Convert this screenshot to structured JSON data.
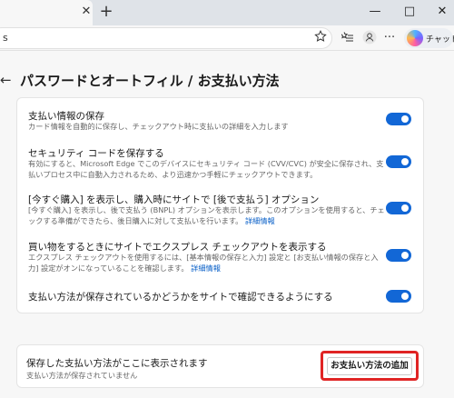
{
  "browser": {
    "tab_close": "✕",
    "new_tab": "+",
    "minimize": "—",
    "maximize": "□",
    "close": "✕",
    "address_text": "s",
    "copilot_label": "チャット"
  },
  "page": {
    "back": "←",
    "title": "パスワードとオートフィル / お支払い方法"
  },
  "settings": [
    {
      "title": "支払い情報の保存",
      "desc": "カード情報を自動的に保存し、チェックアウト時に支払いの詳細を入力します",
      "link": "",
      "enabled": true
    },
    {
      "title": "セキュリティ コードを保存する",
      "desc": "有効にすると、Microsoft Edge でこのデバイスにセキュリティ コード (CVV/CVC) が安全に保存され、支払いプロセス中に自動入力されるため、より迅速かつ手軽にチェックアウトできます。",
      "link": "",
      "enabled": true
    },
    {
      "title": "[今すぐ購入] を表示し、購入時にサイトで [後で支払う] オプション",
      "desc": "[今すぐ購入] を表示し、後で支払う (BNPL) オプションを表示します。このオプションを使用すると、チェックする準備ができたら、後日購入に対して支払いを行います。",
      "link": "詳細情報",
      "enabled": true
    },
    {
      "title": "買い物をするときにサイトでエクスプレス チェックアウトを表示する",
      "desc": "エクスプレス チェックアウトを使用するには、[基本情報の保存と入力] 設定と [お支払い情報の保存と入力] 設定がオンになっていることを確認します。",
      "link": "詳細情報",
      "enabled": true
    },
    {
      "title": "支払い方法が保存されているかどうかをサイトで確認できるようにする",
      "desc": "",
      "link": "",
      "enabled": true
    }
  ],
  "saved_methods": {
    "title": "保存した支払い方法がここに表示されます",
    "subtitle": "支払い方法が保存されていません",
    "add_button": "お支払い方法の追加"
  }
}
